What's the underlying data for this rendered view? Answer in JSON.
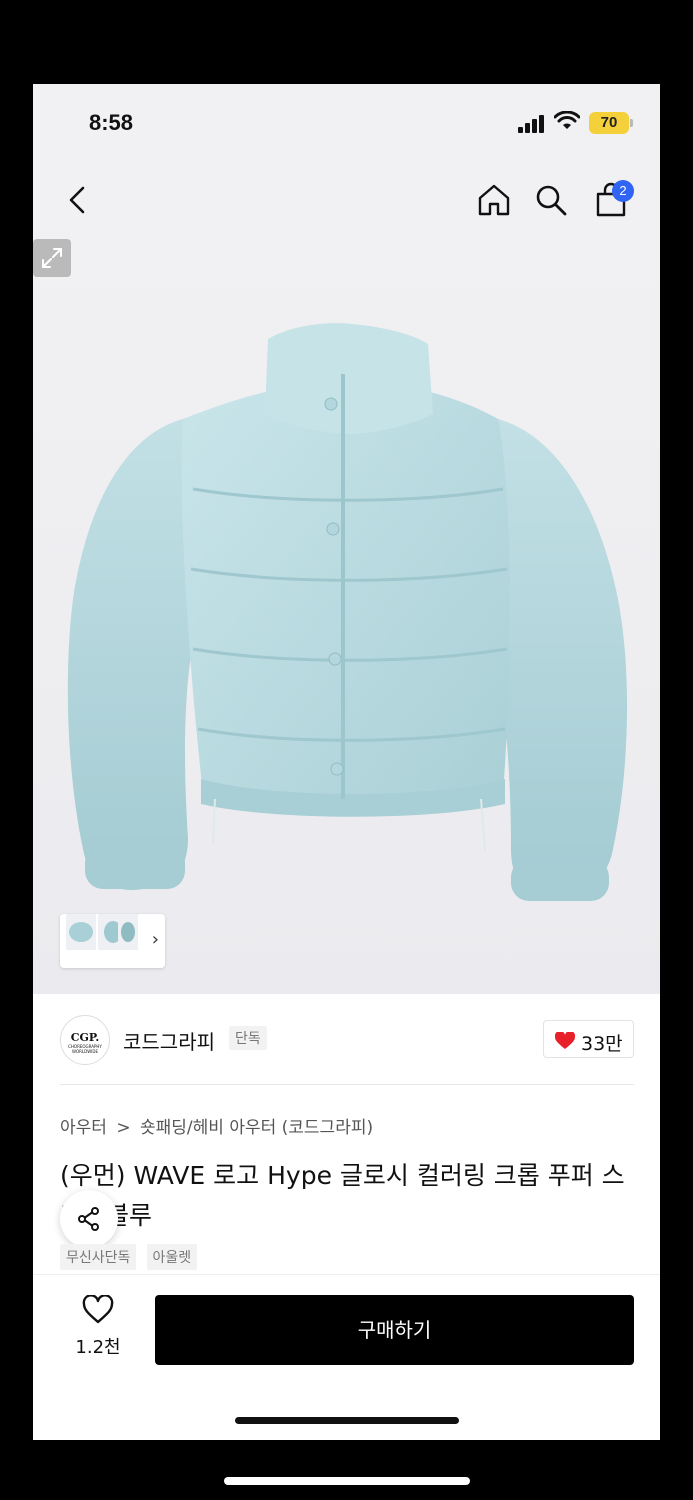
{
  "status_bar": {
    "time": "8:58",
    "battery": "70"
  },
  "header": {
    "cart_badge": "2"
  },
  "brand": {
    "logo_text": "CGP.",
    "logo_sub": "CHOREOGRAPHY WORLDWIDE",
    "name": "코드그라피",
    "tag": "단독",
    "likes": "33만"
  },
  "breadcrumb": [
    "아우터",
    ">",
    "숏패딩/헤비 아우터 (코드그라피)"
  ],
  "product": {
    "title": "(우먼) WAVE 로고 Hype 글로시 컬러링 크롭 푸퍼 스카이블루",
    "tags": [
      "무신사단독",
      "아울렛"
    ]
  },
  "bottom_bar": {
    "wish_count": "1.2천",
    "buy_label": "구매하기"
  },
  "colors": {
    "accent_badge": "#2f64f5",
    "heart": "#e8202a",
    "jacket": "#bcdde2"
  }
}
